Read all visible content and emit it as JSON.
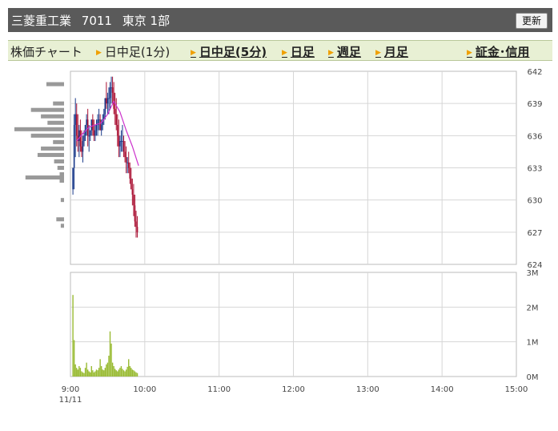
{
  "header": {
    "company": "三菱重工業",
    "code": "7011",
    "market": "東京 1部",
    "refresh_label": "更新"
  },
  "nav": {
    "items": [
      {
        "label": "株価チャート",
        "link": false,
        "arrow": false
      },
      {
        "label": "日中足(1分)",
        "link": false,
        "arrow": true
      },
      {
        "label": "日中足(5分)",
        "link": true,
        "arrow": true
      },
      {
        "label": "日足",
        "link": true,
        "arrow": true
      },
      {
        "label": "週足",
        "link": true,
        "arrow": true
      },
      {
        "label": "月足",
        "link": true,
        "arrow": true
      },
      {
        "label": "証金･信用",
        "link": true,
        "arrow": true
      }
    ]
  },
  "colors": {
    "candle": "#1a3a8a",
    "candle_down": "#aa1133",
    "moving_average": "#cc33cc",
    "volume": "#99bb33",
    "price_volume": "#999999",
    "grid": "#d6d6d6"
  },
  "chart_data": [
    {
      "type": "line",
      "panel": "price",
      "x_unit": "time",
      "xlim": [
        "9:00",
        "15:00"
      ],
      "ylim": [
        624,
        642
      ],
      "y_ticks": [
        "642",
        "639",
        "636",
        "633",
        "630",
        "627",
        "624"
      ],
      "x_ticks": [
        "9:00",
        "10:00",
        "11:00",
        "12:00",
        "13:00",
        "14:00",
        "15:00"
      ],
      "date_label": "11/11",
      "grid": true,
      "series": [
        {
          "kind": "candles",
          "x": [
            "9:02",
            "9:03",
            "9:04",
            "9:05",
            "9:06",
            "9:07",
            "9:08",
            "9:09",
            "9:10",
            "9:11",
            "9:12",
            "9:13",
            "9:14",
            "9:15",
            "9:16",
            "9:17",
            "9:18",
            "9:19",
            "9:20",
            "9:21",
            "9:22",
            "9:23",
            "9:24",
            "9:25",
            "9:26",
            "9:27",
            "9:28",
            "9:29",
            "9:30",
            "9:31",
            "9:32",
            "9:33",
            "9:34",
            "9:35",
            "9:36",
            "9:37",
            "9:38",
            "9:39",
            "9:40",
            "9:41",
            "9:42",
            "9:43",
            "9:44",
            "9:45",
            "9:46",
            "9:47",
            "9:48",
            "9:49",
            "9:50",
            "9:51",
            "9:52",
            "9:53",
            "9:54"
          ],
          "high": [
            633,
            638,
            639.5,
            639,
            638,
            637,
            637.5,
            636.5,
            636,
            636.5,
            637,
            638,
            638.5,
            637,
            636.5,
            637.5,
            638,
            637.5,
            637,
            637.5,
            638,
            638.5,
            638,
            637.5,
            638,
            638.5,
            639.5,
            641,
            640,
            640.5,
            641,
            641.5,
            641.5,
            641,
            640,
            639.5,
            638,
            637.5,
            636,
            636.5,
            637,
            636,
            635.5,
            635,
            634,
            634.5,
            633.5,
            633,
            632,
            631.5,
            630.5,
            629,
            628.5
          ],
          "low": [
            630.5,
            631,
            634,
            635,
            634.5,
            634,
            634.5,
            634,
            633.5,
            635,
            635.5,
            636,
            635,
            634.5,
            635.5,
            636,
            636,
            635.5,
            635.5,
            636,
            636,
            636.5,
            636.5,
            636,
            636.5,
            637,
            637.5,
            638.5,
            638,
            638,
            638.5,
            639,
            639,
            638,
            637,
            636.5,
            635,
            634,
            634,
            634.5,
            634.5,
            634,
            633.5,
            632.5,
            632.5,
            632.5,
            631.5,
            631,
            629.5,
            628.5,
            627.5,
            626.5,
            626.5
          ],
          "open": [
            631,
            633,
            637,
            638,
            636,
            635.5,
            636.5,
            635,
            634.5,
            635.5,
            636,
            637,
            637.5,
            636,
            636,
            636.5,
            637.5,
            636.5,
            636,
            636.5,
            637,
            637.5,
            637.5,
            636.5,
            637,
            637.5,
            638,
            639.5,
            639,
            639.5,
            639.5,
            640.5,
            640.5,
            640,
            638.5,
            638,
            637,
            636,
            635,
            635.5,
            635.5,
            635.5,
            634.5,
            634,
            633.5,
            633.5,
            633,
            632,
            631,
            630.5,
            629.5,
            628,
            627.5
          ],
          "close": [
            633,
            637,
            638,
            636,
            635.5,
            636.5,
            635,
            634.5,
            635.5,
            636,
            637,
            637.5,
            636,
            636,
            636.5,
            637.5,
            636.5,
            636,
            636.5,
            637,
            637.5,
            637.5,
            636.5,
            637,
            637.5,
            638,
            639.5,
            639,
            639.5,
            639.5,
            640.5,
            640.5,
            640,
            638.5,
            638,
            637,
            636,
            635,
            635.5,
            635.5,
            635.5,
            634.5,
            634,
            633.5,
            633.5,
            633,
            632,
            631,
            630.5,
            629.5,
            628,
            627.5,
            627
          ]
        },
        {
          "kind": "line",
          "x": [
            "9:05",
            "9:10",
            "9:15",
            "9:20",
            "9:25",
            "9:30",
            "9:35",
            "9:40",
            "9:45",
            "9:50",
            "9:55"
          ],
          "values": [
            635.5,
            636.2,
            636.8,
            637,
            637.2,
            638,
            639.2,
            638.2,
            636.5,
            635,
            633.2
          ]
        },
        {
          "kind": "horizontal-bars",
          "y": [
            640.8,
            639,
            638.4,
            637.8,
            637.2,
            636.6,
            636,
            635.4,
            634.8,
            634.2,
            633.6,
            633,
            632.4,
            632.1,
            631.8,
            630,
            628.2,
            627.6
          ],
          "values": [
            32,
            20,
            60,
            42,
            30,
            90,
            60,
            20,
            42,
            48,
            18,
            12,
            8,
            70,
            8,
            6,
            14,
            6
          ]
        }
      ]
    },
    {
      "type": "bar",
      "panel": "volume",
      "x_unit": "time",
      "xlim": [
        "9:00",
        "15:00"
      ],
      "ylim": [
        0,
        3000000
      ],
      "y_ticks": [
        "3M",
        "2M",
        "1M",
        "0M"
      ],
      "grid": true,
      "x": [
        "9:02",
        "9:03",
        "9:04",
        "9:05",
        "9:06",
        "9:07",
        "9:08",
        "9:09",
        "9:10",
        "9:11",
        "9:12",
        "9:13",
        "9:14",
        "9:15",
        "9:16",
        "9:17",
        "9:18",
        "9:19",
        "9:20",
        "9:21",
        "9:22",
        "9:23",
        "9:24",
        "9:25",
        "9:26",
        "9:27",
        "9:28",
        "9:29",
        "9:30",
        "9:31",
        "9:32",
        "9:33",
        "9:34",
        "9:35",
        "9:36",
        "9:37",
        "9:38",
        "9:39",
        "9:40",
        "9:41",
        "9:42",
        "9:43",
        "9:44",
        "9:45",
        "9:46",
        "9:47",
        "9:48",
        "9:49",
        "9:50",
        "9:51",
        "9:52",
        "9:53",
        "9:54"
      ],
      "values": [
        2350000,
        1050000,
        350000,
        250000,
        200000,
        300000,
        250000,
        150000,
        120000,
        100000,
        250000,
        400000,
        200000,
        150000,
        120000,
        300000,
        180000,
        120000,
        150000,
        200000,
        180000,
        250000,
        500000,
        300000,
        200000,
        180000,
        250000,
        350000,
        400000,
        600000,
        1300000,
        950000,
        400000,
        300000,
        220000,
        180000,
        150000,
        200000,
        250000,
        300000,
        220000,
        180000,
        150000,
        200000,
        280000,
        500000,
        300000,
        250000,
        200000,
        180000,
        150000,
        120000,
        100000
      ]
    }
  ]
}
